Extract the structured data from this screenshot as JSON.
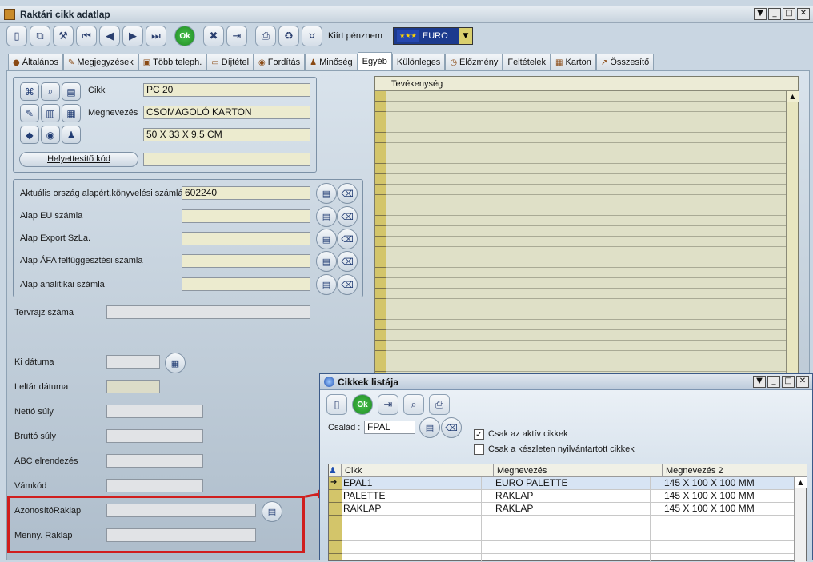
{
  "window": {
    "title": "Raktári cikk adatlap"
  },
  "toolbar": {
    "currency_label": "Kiírt pénznem",
    "currency_value": "EURO",
    "ok_label": "Ok"
  },
  "tabs": [
    {
      "label": "Általános"
    },
    {
      "label": "Megjegyzések"
    },
    {
      "label": "Több teleph."
    },
    {
      "label": "Díjtétel"
    },
    {
      "label": "Fordítás"
    },
    {
      "label": "Minőség"
    },
    {
      "label": "Egyéb"
    },
    {
      "label": "Különleges"
    },
    {
      "label": "Előzmény"
    },
    {
      "label": "Feltételek"
    },
    {
      "label": "Karton"
    },
    {
      "label": "Összesítő"
    }
  ],
  "item": {
    "cikk_label": "Cikk",
    "cikk_value": "PC 20",
    "megnevezes_label": "Megnevezés",
    "megnevezes_value": "CSOMAGOLÓ KARTON",
    "dimensions_value": "50 X 33 X 9,5 CM",
    "helyettesito_button": "Helyettesítő kód"
  },
  "accounts": [
    {
      "label": "Aktuális ország alapért.könyvelési számlája",
      "value": "602240"
    },
    {
      "label": "Alap EU számla",
      "value": ""
    },
    {
      "label": "Alap Export SzLa.",
      "value": ""
    },
    {
      "label": "Alap ÁFA felfüggesztési számla",
      "value": ""
    },
    {
      "label": "Alap analitikai számla",
      "value": ""
    }
  ],
  "fields": {
    "tervrajz": "Tervrajz száma",
    "ki_datuma": "Ki dátuma",
    "leltar": "Leltár dátuma",
    "netto": "Nettó súly",
    "brutto": "Bruttó súly",
    "abc": "ABC elrendezés",
    "vamkod": "Vámkód",
    "azonosito": "AzonosítóRaklap",
    "menny": "Menny. Raklap"
  },
  "activity_grid": {
    "header": "Tevékenység"
  },
  "popup": {
    "title": "Cikkek listája",
    "ok_label": "Ok",
    "csalad_label": "Család :",
    "csalad_value": "FPAL",
    "check_active_label": "Csak az aktív cikkek",
    "check_active": true,
    "check_stock_label": "Csak a készleten nyilvántartott cikkek",
    "check_stock": false,
    "columns": [
      "Cikk",
      "Megnevezés",
      "Megnevezés 2"
    ],
    "rows": [
      {
        "cikk": "EPAL1",
        "megnevezes": "EURO PALETTE",
        "megnevezes2": "145 X 100 X 100 MM"
      },
      {
        "cikk": "PALETTE",
        "megnevezes": "RAKLAP",
        "megnevezes2": "145 X 100 X 100 MM"
      },
      {
        "cikk": "RAKLAP",
        "megnevezes": "RAKLAP",
        "megnevezes2": "145 X 100 X 100 MM"
      }
    ]
  }
}
